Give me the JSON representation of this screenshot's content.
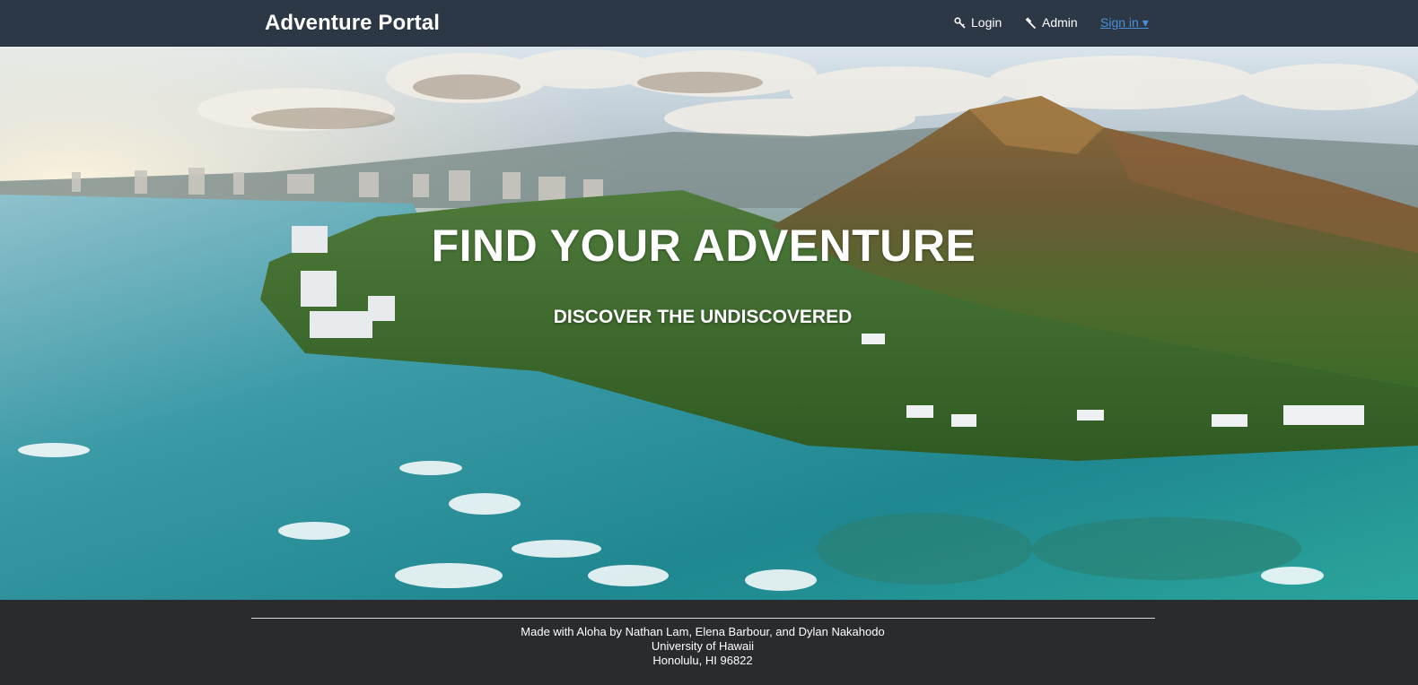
{
  "navbar": {
    "brand": "Adventure Portal",
    "items": [
      {
        "label": "Login",
        "icon": "key-icon"
      },
      {
        "label": "Admin",
        "icon": "gavel-icon"
      },
      {
        "label": "Sign in ▾",
        "icon": ""
      }
    ],
    "background": "#2d3847",
    "link_color": "#4a90d9"
  },
  "hero": {
    "title": "FIND YOUR ADVENTURE",
    "subtitle": "DISCOVER THE UNDISCOVERED"
  },
  "footer": {
    "lines": [
      "Made with Aloha by Nathan Lam, Elena Barbour, and Dylan Nakahodo",
      "University of Hawaii",
      "Honolulu, HI 96822"
    ],
    "background": "#2a2b2d"
  }
}
